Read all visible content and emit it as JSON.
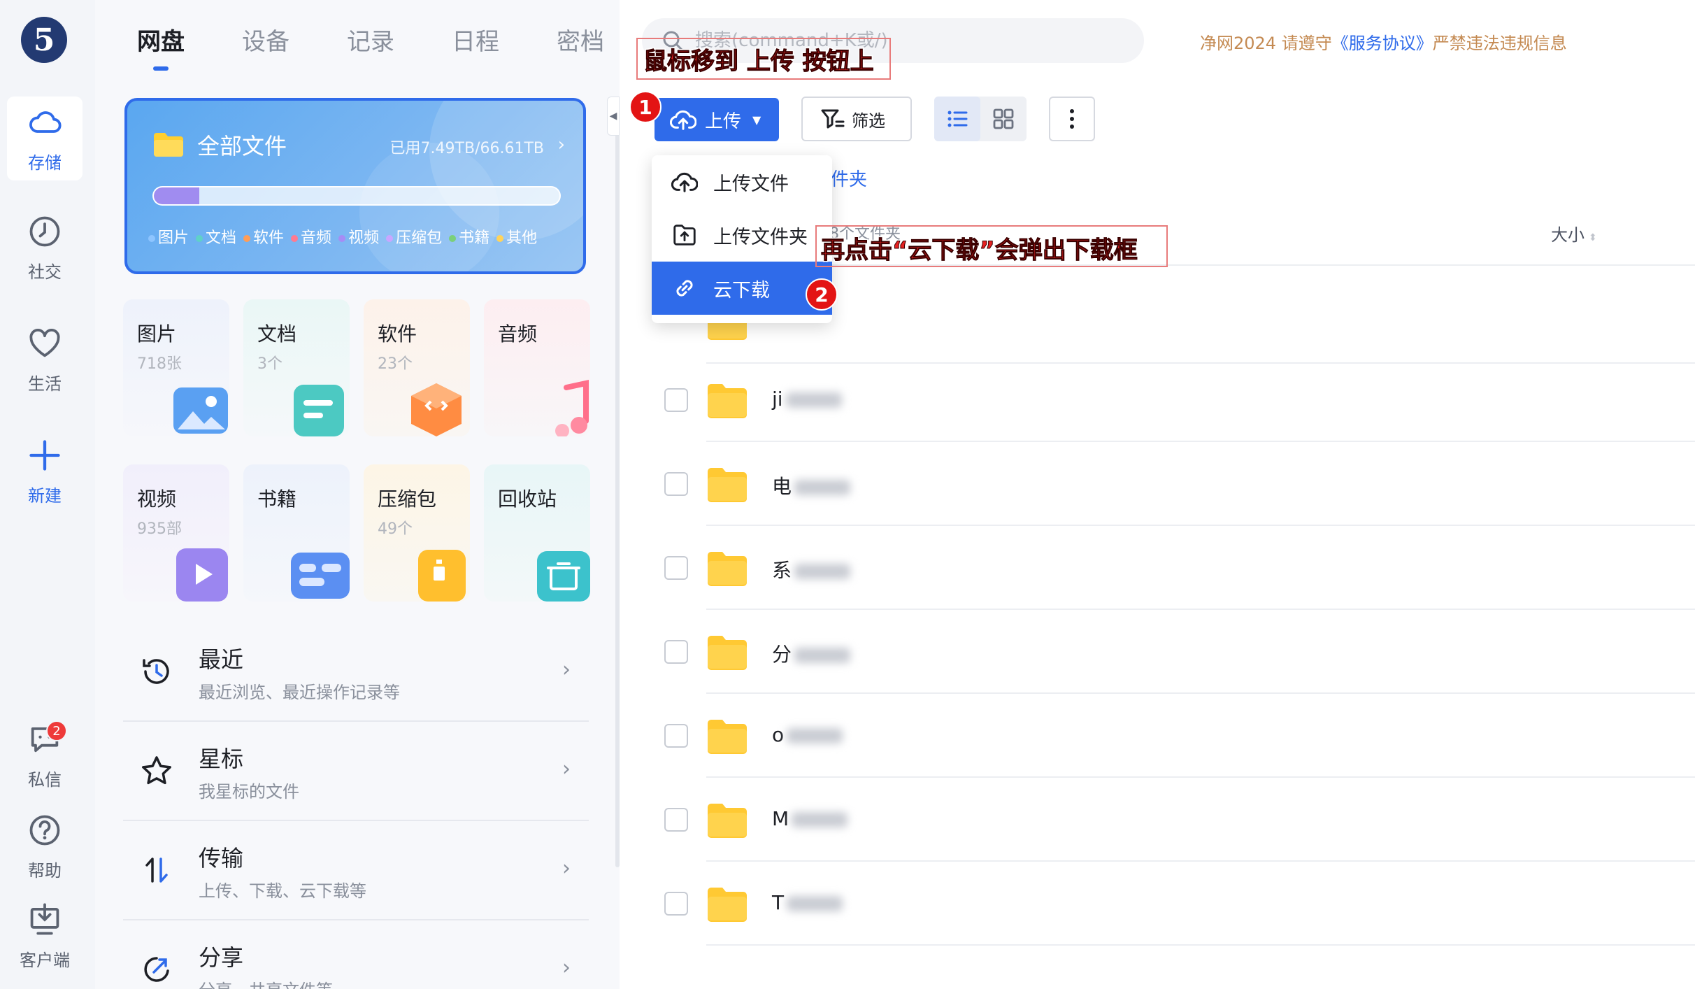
{
  "rail": {
    "logo": "5",
    "items": [
      {
        "label": "存储"
      },
      {
        "label": "社交"
      },
      {
        "label": "生活"
      },
      {
        "label": "新建"
      },
      {
        "label": "私信",
        "badge": "2"
      },
      {
        "label": "帮助"
      },
      {
        "label": "客户端"
      }
    ]
  },
  "tabs": [
    {
      "label": "网盘"
    },
    {
      "label": "设备"
    },
    {
      "label": "记录"
    },
    {
      "label": "日程"
    },
    {
      "label": "密档"
    }
  ],
  "all_files": {
    "title": "全部文件",
    "usage": "已用7.49TB/66.61TB",
    "used_fraction": 0.112,
    "legend": [
      {
        "label": "图片",
        "color": "#8ec5ff"
      },
      {
        "label": "文档",
        "color": "#5fd1c8"
      },
      {
        "label": "软件",
        "color": "#ff9d57"
      },
      {
        "label": "音频",
        "color": "#ff7a90"
      },
      {
        "label": "视频",
        "color": "#a68cf5"
      },
      {
        "label": "压缩包",
        "color": "#c9a6ff"
      },
      {
        "label": "书籍",
        "color": "#7ad07a"
      },
      {
        "label": "其他",
        "color": "#ffd35a"
      }
    ]
  },
  "categories": [
    {
      "name": "图片",
      "count": "718张"
    },
    {
      "name": "文档",
      "count": "3个"
    },
    {
      "name": "软件",
      "count": "23个"
    },
    {
      "name": "音频",
      "count": ""
    },
    {
      "name": "视频",
      "count": "935部"
    },
    {
      "name": "书籍",
      "count": ""
    },
    {
      "name": "压缩包",
      "count": "49个"
    },
    {
      "name": "回收站",
      "count": ""
    }
  ],
  "menu": [
    {
      "title": "最近",
      "sub": "最近浏览、最近操作记录等"
    },
    {
      "title": "星标",
      "sub": "我星标的文件"
    },
    {
      "title": "传输",
      "sub": "上传、下载、云下载等"
    },
    {
      "title": "分享",
      "sub": "分享、共享文件等"
    }
  ],
  "search": {
    "placeholder": "搜索(command+K或/)"
  },
  "notice": {
    "prefix": "净网2024 请遵守",
    "link": "《服务协议》",
    "suffix": "严禁违法违规信息"
  },
  "toolbar": {
    "upload": "上传",
    "filter": "筛选"
  },
  "dropdown": [
    {
      "label": "上传文件"
    },
    {
      "label": "上传文件夹"
    },
    {
      "label": "云下载"
    }
  ],
  "list": {
    "crumb": "件夹",
    "count": "8个文件夹",
    "size_header": "大小",
    "rows": [
      {
        "name": "ji"
      },
      {
        "name": "电"
      },
      {
        "name": "系"
      },
      {
        "name": "分"
      },
      {
        "name": "o"
      },
      {
        "name": "M"
      },
      {
        "name": "T"
      }
    ]
  },
  "annotations": {
    "step1_text": "鼠标移到 上传 按钮上",
    "step2_text": "再点击“云下载”会弹出下载框",
    "step1_num": "1",
    "step2_num": "2"
  }
}
